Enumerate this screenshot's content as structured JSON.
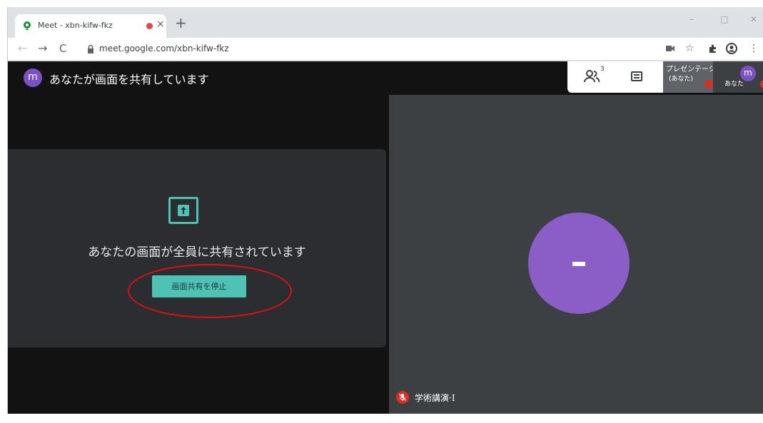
{
  "browser": {
    "tab_title": "Meet - xbn-kifw-fkz",
    "tab_close": "×",
    "new_tab": "+",
    "url": "meet.google.com/xbn-kifw-fkz",
    "window_controls": [
      "–",
      "□",
      "✕"
    ],
    "recording_dot_color": "#e04848",
    "toolbar_icons": [
      "camera-icon",
      "star-icon",
      "extensions-icon",
      "profile-icon",
      "menu-icon"
    ]
  },
  "meet": {
    "user_initial": "m",
    "share_banner": "あなたが画面を共有しています",
    "people_count": "3",
    "presentation_tile_label": "プレゼンテーシ",
    "presentation_tile_sub": "(あなた)",
    "self_tile_label": "あなた",
    "share_message": "あなたの画面が全員に共有されています",
    "stop_share_button": "画面共有を停止",
    "participant_name": "学術講演·I",
    "accent_color": "#4ec3b5",
    "avatar_color": "#8a5ec6",
    "highlight_color": "#e01010"
  }
}
